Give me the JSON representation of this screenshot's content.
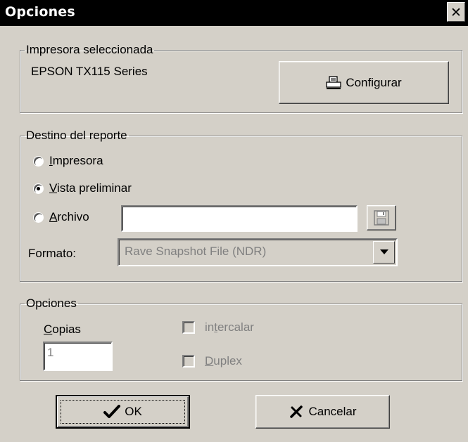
{
  "window": {
    "title": "Opciones",
    "close_glyph": "✕"
  },
  "printer_group": {
    "legend": "Impresora seleccionada",
    "printer_name": "EPSON TX115 Series",
    "configure_label": "Configurar",
    "configure_icon": "printer-icon"
  },
  "destination_group": {
    "legend": "Destino del reporte",
    "options": [
      {
        "accel": "I",
        "rest": "mpresora",
        "selected": false
      },
      {
        "accel": "V",
        "rest": "ista preliminar",
        "selected": true
      },
      {
        "accel": "A",
        "rest": "rchivo",
        "selected": false
      }
    ],
    "file_value": "",
    "save_icon": "floppy-disk-icon",
    "format_label": "Formato:",
    "format_value": "Rave Snapshot File (NDR)"
  },
  "options_group": {
    "legend": "Opciones",
    "copies_accel": "C",
    "copies_rest": "opias",
    "copies_value": "1",
    "collate_before": "in",
    "collate_accel": "t",
    "collate_after": "ercalar",
    "duplex_accel": "D",
    "duplex_rest": "uplex",
    "collate_checked": false,
    "duplex_checked": false
  },
  "buttons": {
    "ok_label": "OK",
    "ok_icon": "checkmark-icon",
    "cancel_label": "Cancelar",
    "cancel_icon": "cancel-x-icon"
  }
}
